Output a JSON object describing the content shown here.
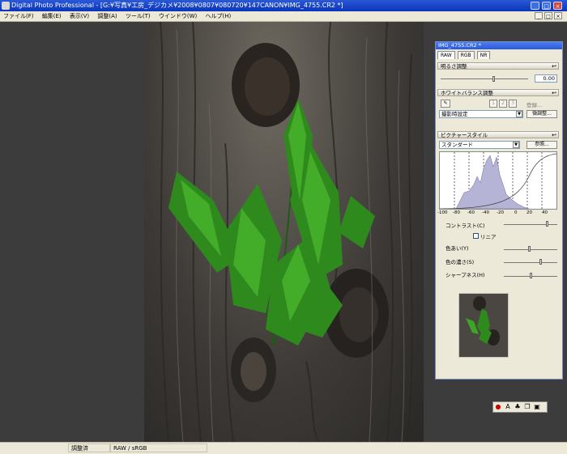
{
  "window": {
    "title": "Digital Photo Professional - [G:¥写真¥工房_デジカメ¥2008¥0807¥080720¥147CANON¥IMG_4755.CR2 *]",
    "minimize": "_",
    "maximize": "□",
    "close": "×"
  },
  "menu": {
    "items": [
      "ファイル(F)",
      "編集(E)",
      "表示(V)",
      "調整(A)",
      "ツール(T)",
      "ウインドウ(W)",
      "ヘルプ(H)"
    ],
    "mdi_buttons": [
      "_",
      "□",
      "×"
    ]
  },
  "panel": {
    "title": "IMG_4755.CR2 *",
    "tabs": [
      "RAW",
      "RGB",
      "NR"
    ],
    "brightness": {
      "header": "明るさ調整",
      "value": "0.00"
    },
    "white_balance": {
      "header": "ホワイトバランス調整",
      "picker_icon": "eyedropper-icon",
      "presets": [
        "1",
        "2",
        "3"
      ],
      "register_label": "登録...",
      "mode": "撮影時設定",
      "fine_tune_label": "微調整..."
    },
    "picture_style": {
      "header": "ピクチャースタイル",
      "style": "スタンダード",
      "browse_label": "参照..."
    },
    "histogram_ticks": [
      "-100",
      "-80",
      "-60",
      "-40",
      "-20",
      "0",
      "20",
      "40"
    ],
    "contrast": {
      "label": "コントラスト(C)"
    },
    "linear": {
      "label": "リニア",
      "checked": false
    },
    "color_tone": {
      "label": "色あい(Y)"
    },
    "saturation": {
      "label": "色の濃さ(S)"
    },
    "sharpness": {
      "label": "シャープネス(H)"
    }
  },
  "status": {
    "cells": [
      "調整済",
      "RAW / sRGB"
    ]
  },
  "tool_palette": {
    "icons": [
      "red-eye-icon",
      "text-icon",
      "stamp-icon",
      "copy-icon",
      "paste-icon"
    ]
  }
}
